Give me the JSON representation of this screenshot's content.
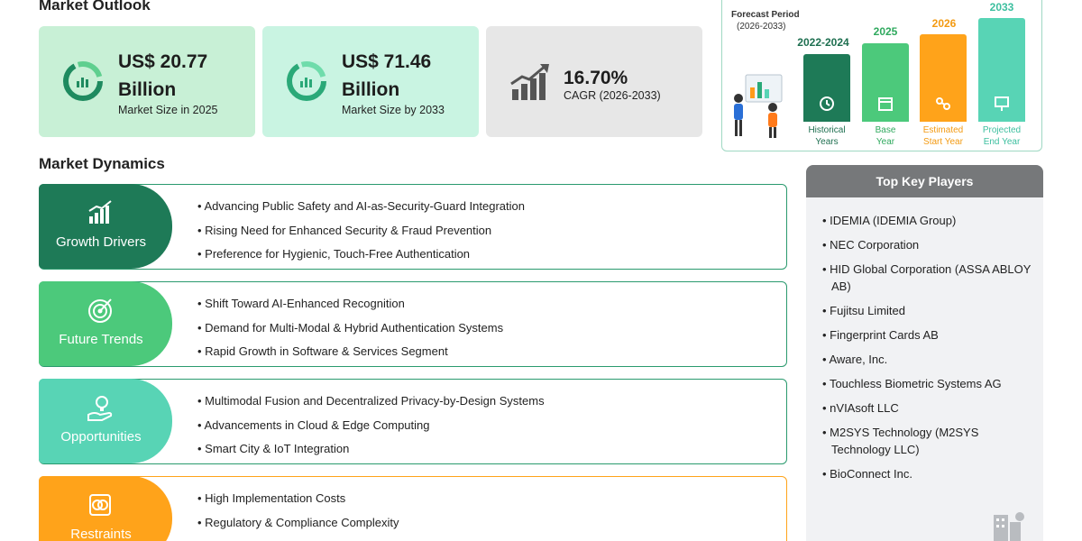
{
  "market_outlook": {
    "title": "Market Outlook",
    "cards": [
      {
        "value_line1": "US$ 20.77",
        "value_line2": "Billion",
        "caption": "Market Size in 2025",
        "bg": "#c8f0d6"
      },
      {
        "value_line1": "US$ 71.46",
        "value_line2": "Billion",
        "caption": "Market Size by 2033",
        "bg": "#c9f4e2"
      },
      {
        "value": "16.70%",
        "caption": "CAGR (2026-2033)",
        "bg": "#e7e7e7"
      }
    ]
  },
  "forecast": {
    "label": "Forecast Period",
    "range": "(2026-2033)",
    "bars": [
      {
        "year": "2022-2024",
        "caption_line1": "Historical",
        "caption_line2": "Years",
        "color": "#1e7a57",
        "text_color": "#1e6f50",
        "icon": "history-icon"
      },
      {
        "year": "2025",
        "caption_line1": "Base",
        "caption_line2": "Year",
        "color": "#4cc97b",
        "text_color": "#2fa95e",
        "icon": "calendar-icon"
      },
      {
        "year": "2026",
        "caption_line1": "Estimated",
        "caption_line2": "Start Year",
        "color": "#ffa31a",
        "text_color": "#f39a12",
        "icon": "people-network-icon"
      },
      {
        "year": "2033",
        "caption_line1": "Projected",
        "caption_line2": "End Year",
        "color": "#58d4b5",
        "text_color": "#3cbf9f",
        "icon": "presentation-icon"
      }
    ]
  },
  "market_dynamics": {
    "title": "Market Dynamics",
    "rows": [
      {
        "label": "Growth Drivers",
        "color": "#1e7a57",
        "icon": "growth-chart-icon",
        "items": [
          "Advancing Public Safety and AI-as-Security-Guard Integration",
          "Rising Need for Enhanced Security & Fraud Prevention",
          "Preference for Hygienic, Touch-Free Authentication"
        ]
      },
      {
        "label": "Future Trends",
        "color": "#4cc97b",
        "icon": "target-icon",
        "items": [
          "Shift Toward AI-Enhanced Recognition",
          "Demand for Multi-Modal & Hybrid Authentication Systems",
          "Rapid Growth in Software & Services Segment"
        ]
      },
      {
        "label": "Opportunities",
        "color": "#58d4b5",
        "icon": "lightbulb-hand-icon",
        "items": [
          "Multimodal Fusion and Decentralized Privacy-by-Design Systems",
          "Advancements in Cloud & Edge Computing",
          "Smart City & IoT Integration"
        ]
      },
      {
        "label": "Restraints",
        "color": "#ffa31a",
        "icon": "restraint-icon",
        "items": [
          "High Implementation Costs",
          "Regulatory & Compliance Complexity"
        ]
      }
    ]
  },
  "key_players": {
    "title": "Top Key Players",
    "items": [
      "IDEMIA (IDEMIA Group)",
      "NEC Corporation",
      "HID Global Corporation (ASSA ABLOY AB)",
      "Fujitsu Limited",
      "Fingerprint Cards AB",
      "Aware, Inc.",
      "Touchless Biometric Systems AG",
      "nVIAsoft LLC",
      "M2SYS Technology (M2SYS Technology LLC)",
      "BioConnect Inc."
    ]
  }
}
